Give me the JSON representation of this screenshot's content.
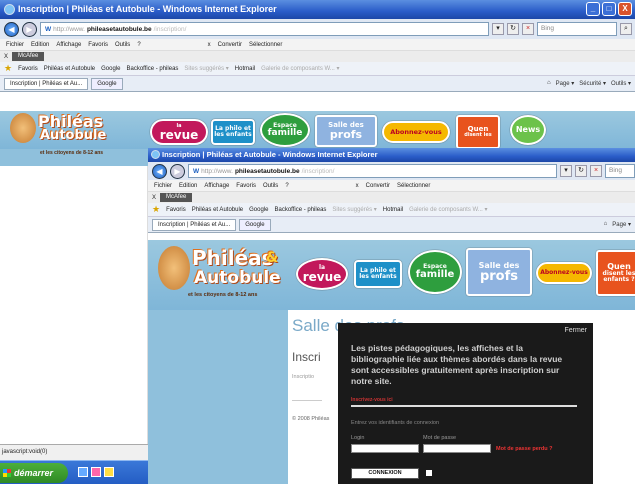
{
  "window": {
    "title": "Inscription | Philéas et Autobule - Windows Internet Explorer",
    "controls": [
      "_",
      "□",
      "X"
    ]
  },
  "address": {
    "prefix": "http://www.",
    "host": "phileasetautobule.be",
    "path": "/inscription/",
    "search_placeholder": "Bing"
  },
  "menu": [
    "Fichier",
    "Edition",
    "Affichage",
    "Favoris",
    "Outils",
    "?"
  ],
  "menu_extra": {
    "convert": "Convertir",
    "select": "Sélectionner",
    "close_x": "x"
  },
  "mcafee": {
    "close": "X",
    "label": "McAfee"
  },
  "favorites": {
    "favoris": "Favoris",
    "items": [
      "Philéas et Autobule",
      "Google",
      "Backoffice - phileas",
      "Sites suggérés ▾",
      "Hotmail",
      "Galerie de composants W... ▾"
    ]
  },
  "tabs": {
    "items": [
      "Inscription | Philéas et Au...",
      "Google"
    ],
    "commands": [
      "Page ▾",
      "Sécurité ▾",
      "Outils ▾"
    ]
  },
  "logo": {
    "name1": "Philéas",
    "amp": "&",
    "name2": "Autobule",
    "tagline": "et les citoyens de 8-12 ans"
  },
  "nav_pills": {
    "revue_small": "la",
    "revue": "revue",
    "phileo_line1": "La philo et",
    "phileo_line2": "les enfants",
    "famille_small": "Espace",
    "famille": "famille",
    "salle_small": "Salle des",
    "salle": "profs",
    "abonnez": "Abonnez-vous",
    "quen_line1": "Quen",
    "quen_line2": "disent les",
    "quen_line3": "enfants ?",
    "news": "News"
  },
  "page": {
    "heading": "Salle des profs",
    "subheading": "Inscri",
    "small": "Inscriptio",
    "copyright": "© 2008 Philéas"
  },
  "status": {
    "text": "javascript:void(0)"
  },
  "taskbar": {
    "start": "démarrer"
  },
  "modal": {
    "close": "Fermer",
    "message": "Les pistes pédagogiques, les affiches et la bibliographie liée aux thèmes abordés dans la revue sont accessibles gratuitement après inscription sur notre site.",
    "required": "Inscrivez-vous ici",
    "hint": "Entrez vos identifiants de connexion",
    "login_label": "Login",
    "password_label": "Mot de passe",
    "forgot": "Mot de passe perdu ?",
    "login_button": "CONNEXION"
  },
  "colors": {
    "titlebar": "#2a5cc8",
    "banner": "#8fc0dc",
    "revue": "#c2185b",
    "phileo": "#1e90c8",
    "famille": "#2e9e3e",
    "salle": "#8fb3e0",
    "abonnez": "#f5b800",
    "quen": "#e8531e",
    "news": "#6cc24a"
  }
}
